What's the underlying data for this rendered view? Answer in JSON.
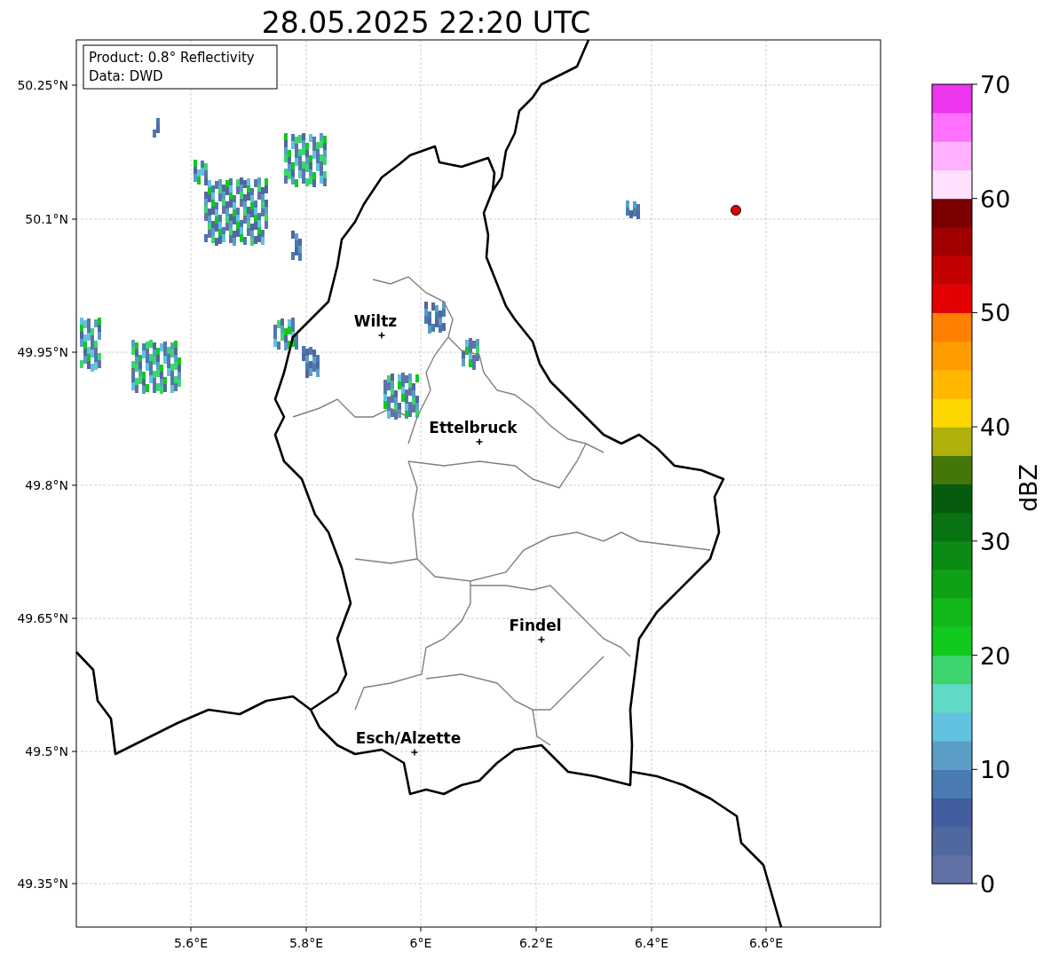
{
  "title": "28.05.2025 22:20 UTC",
  "info_box": {
    "lines": [
      "Product: 0.8° Reflectivity",
      "Data: DWD"
    ]
  },
  "y_ticks": [
    "50.25°N",
    "50.1°N",
    "49.95°N",
    "49.8°N",
    "49.65°N",
    "49.5°N",
    "49.35°N"
  ],
  "x_ticks": [
    "5.6°E",
    "5.8°E",
    "6°E",
    "6.2°E",
    "6.4°E",
    "6.6°E"
  ],
  "cities": [
    {
      "name": "Wiltz"
    },
    {
      "name": "Ettelbruck"
    },
    {
      "name": "Findel"
    },
    {
      "name": "Esch/Alzette"
    }
  ],
  "colorbar": {
    "label": "dBZ",
    "ticks": [
      "70",
      "60",
      "50",
      "40",
      "30",
      "20",
      "10",
      "0"
    ],
    "bands": [
      {
        "color": "#6272a6"
      },
      {
        "color": "#51679f"
      },
      {
        "color": "#425ea0"
      },
      {
        "color": "#4a7ab2"
      },
      {
        "color": "#5a9ec8"
      },
      {
        "color": "#63c1e0"
      },
      {
        "color": "#60d9c5"
      },
      {
        "color": "#3dd56e"
      },
      {
        "color": "#12c91e"
      },
      {
        "color": "#10b81a"
      },
      {
        "color": "#0ea015"
      },
      {
        "color": "#0b8a14"
      },
      {
        "color": "#097212"
      },
      {
        "color": "#065c0e"
      },
      {
        "color": "#44760a"
      },
      {
        "color": "#b0b10a"
      },
      {
        "color": "#ffd700"
      },
      {
        "color": "#ffb700"
      },
      {
        "color": "#ff9c00"
      },
      {
        "color": "#ff7f00"
      },
      {
        "color": "#e30000"
      },
      {
        "color": "#c30000"
      },
      {
        "color": "#a00000"
      },
      {
        "color": "#7a0000"
      },
      {
        "color": "#ffe0ff"
      },
      {
        "color": "#ffb0ff"
      },
      {
        "color": "#ff70ff"
      },
      {
        "color": "#ee35ee"
      }
    ]
  }
}
